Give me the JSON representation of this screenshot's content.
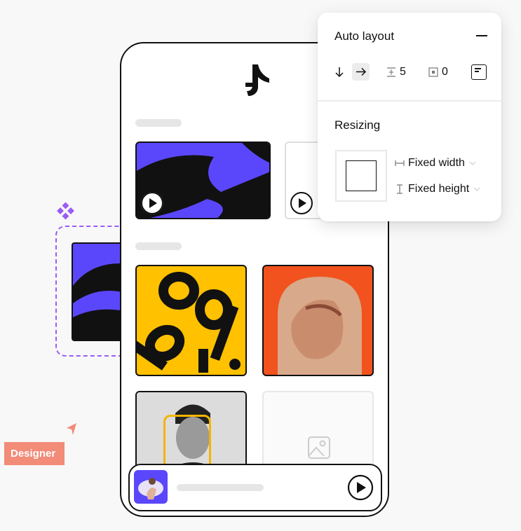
{
  "auto_layout": {
    "title": "Auto layout",
    "collapse_icon": "minus-icon",
    "direction_vertical_icon": "arrow-down-icon",
    "direction_horizontal_icon": "arrow-right-icon",
    "spacing_icon": "spacing-icon",
    "spacing_value": "5",
    "padding_icon": "padding-icon",
    "padding_value": "0",
    "alignment_icon": "align-top-left-icon"
  },
  "resizing": {
    "title": "Resizing",
    "width_label": "Fixed width",
    "height_label": "Fixed height"
  },
  "cursor_label": "Designer",
  "colors": {
    "accent_purple": "#5b47fb",
    "poster_yellow": "#ffc100",
    "poster_orange": "#f2521d",
    "designer_tag": "#f28b78",
    "selection_dashed": "#9b5cf6"
  }
}
